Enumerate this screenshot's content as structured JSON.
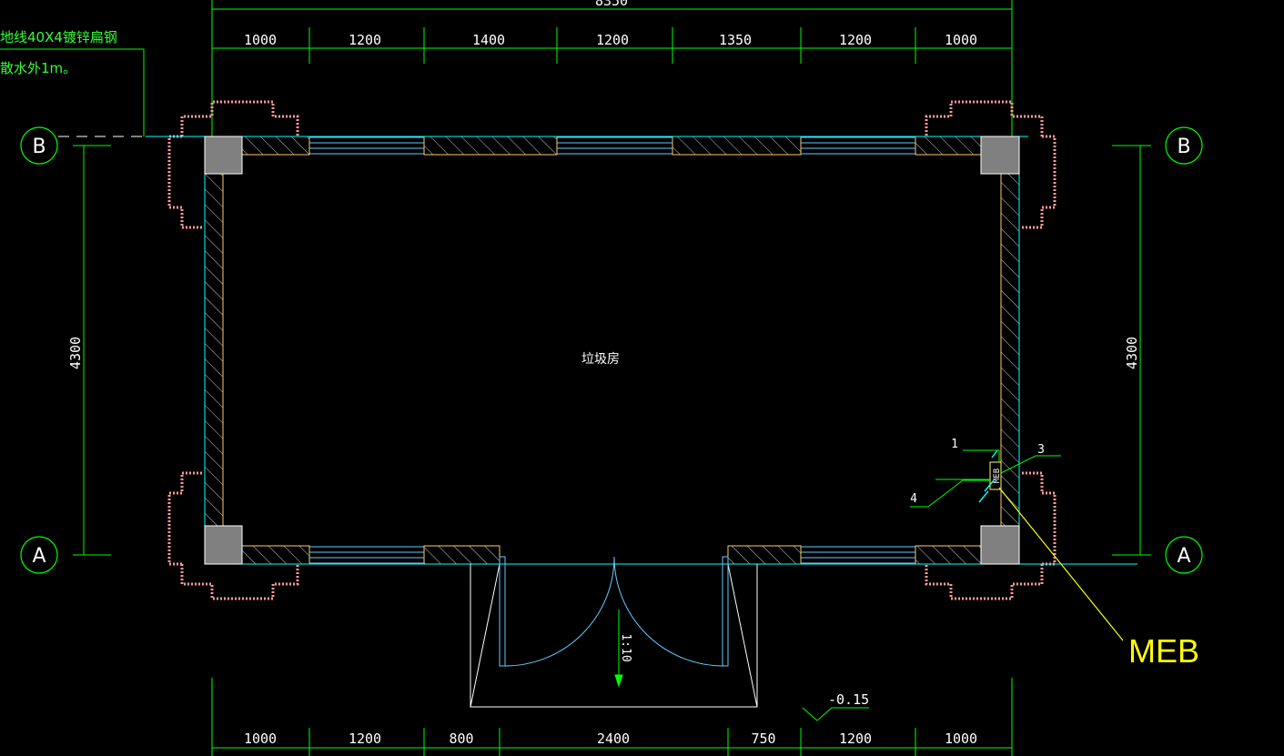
{
  "colors": {
    "background": "#000000",
    "dimension_line": "#00ff00",
    "wall": "#00ffff",
    "column": "#808080",
    "foundation": "#ff9999",
    "meb": "#ffff00",
    "text": "#ffffff"
  },
  "dimensions": {
    "top_total": "8350",
    "top_segments": [
      "1000",
      "1200",
      "1400",
      "1200",
      "1350",
      "1200",
      "1000"
    ],
    "bottom_segments": [
      "1000",
      "1200",
      "800",
      "2400",
      "750",
      "1200",
      "1000"
    ],
    "left_height": "4300",
    "right_height": "4300"
  },
  "axes": {
    "top_left": "B",
    "top_right": "B",
    "bottom_left": "A",
    "bottom_right": "A"
  },
  "notes": {
    "line1": "地线40X4镀锌扁钢",
    "line2": "散水外1m。"
  },
  "room": {
    "name": "垃圾房"
  },
  "meb": {
    "label": "MEB",
    "box_label": "MEB",
    "callouts": [
      "1",
      "3",
      "4"
    ]
  },
  "ramp": {
    "slope_label": "1:10"
  },
  "elevation": {
    "value": "-0.15"
  }
}
